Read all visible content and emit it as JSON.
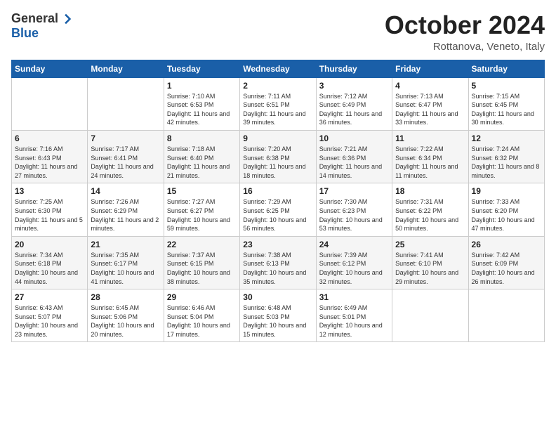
{
  "header": {
    "logo_general": "General",
    "logo_blue": "Blue",
    "month_title": "October 2024",
    "location": "Rottanova, Veneto, Italy"
  },
  "weekdays": [
    "Sunday",
    "Monday",
    "Tuesday",
    "Wednesday",
    "Thursday",
    "Friday",
    "Saturday"
  ],
  "weeks": [
    [
      {
        "day": "",
        "info": ""
      },
      {
        "day": "",
        "info": ""
      },
      {
        "day": "1",
        "info": "Sunrise: 7:10 AM\nSunset: 6:53 PM\nDaylight: 11 hours and 42 minutes."
      },
      {
        "day": "2",
        "info": "Sunrise: 7:11 AM\nSunset: 6:51 PM\nDaylight: 11 hours and 39 minutes."
      },
      {
        "day": "3",
        "info": "Sunrise: 7:12 AM\nSunset: 6:49 PM\nDaylight: 11 hours and 36 minutes."
      },
      {
        "day": "4",
        "info": "Sunrise: 7:13 AM\nSunset: 6:47 PM\nDaylight: 11 hours and 33 minutes."
      },
      {
        "day": "5",
        "info": "Sunrise: 7:15 AM\nSunset: 6:45 PM\nDaylight: 11 hours and 30 minutes."
      }
    ],
    [
      {
        "day": "6",
        "info": "Sunrise: 7:16 AM\nSunset: 6:43 PM\nDaylight: 11 hours and 27 minutes."
      },
      {
        "day": "7",
        "info": "Sunrise: 7:17 AM\nSunset: 6:41 PM\nDaylight: 11 hours and 24 minutes."
      },
      {
        "day": "8",
        "info": "Sunrise: 7:18 AM\nSunset: 6:40 PM\nDaylight: 11 hours and 21 minutes."
      },
      {
        "day": "9",
        "info": "Sunrise: 7:20 AM\nSunset: 6:38 PM\nDaylight: 11 hours and 18 minutes."
      },
      {
        "day": "10",
        "info": "Sunrise: 7:21 AM\nSunset: 6:36 PM\nDaylight: 11 hours and 14 minutes."
      },
      {
        "day": "11",
        "info": "Sunrise: 7:22 AM\nSunset: 6:34 PM\nDaylight: 11 hours and 11 minutes."
      },
      {
        "day": "12",
        "info": "Sunrise: 7:24 AM\nSunset: 6:32 PM\nDaylight: 11 hours and 8 minutes."
      }
    ],
    [
      {
        "day": "13",
        "info": "Sunrise: 7:25 AM\nSunset: 6:30 PM\nDaylight: 11 hours and 5 minutes."
      },
      {
        "day": "14",
        "info": "Sunrise: 7:26 AM\nSunset: 6:29 PM\nDaylight: 11 hours and 2 minutes."
      },
      {
        "day": "15",
        "info": "Sunrise: 7:27 AM\nSunset: 6:27 PM\nDaylight: 10 hours and 59 minutes."
      },
      {
        "day": "16",
        "info": "Sunrise: 7:29 AM\nSunset: 6:25 PM\nDaylight: 10 hours and 56 minutes."
      },
      {
        "day": "17",
        "info": "Sunrise: 7:30 AM\nSunset: 6:23 PM\nDaylight: 10 hours and 53 minutes."
      },
      {
        "day": "18",
        "info": "Sunrise: 7:31 AM\nSunset: 6:22 PM\nDaylight: 10 hours and 50 minutes."
      },
      {
        "day": "19",
        "info": "Sunrise: 7:33 AM\nSunset: 6:20 PM\nDaylight: 10 hours and 47 minutes."
      }
    ],
    [
      {
        "day": "20",
        "info": "Sunrise: 7:34 AM\nSunset: 6:18 PM\nDaylight: 10 hours and 44 minutes."
      },
      {
        "day": "21",
        "info": "Sunrise: 7:35 AM\nSunset: 6:17 PM\nDaylight: 10 hours and 41 minutes."
      },
      {
        "day": "22",
        "info": "Sunrise: 7:37 AM\nSunset: 6:15 PM\nDaylight: 10 hours and 38 minutes."
      },
      {
        "day": "23",
        "info": "Sunrise: 7:38 AM\nSunset: 6:13 PM\nDaylight: 10 hours and 35 minutes."
      },
      {
        "day": "24",
        "info": "Sunrise: 7:39 AM\nSunset: 6:12 PM\nDaylight: 10 hours and 32 minutes."
      },
      {
        "day": "25",
        "info": "Sunrise: 7:41 AM\nSunset: 6:10 PM\nDaylight: 10 hours and 29 minutes."
      },
      {
        "day": "26",
        "info": "Sunrise: 7:42 AM\nSunset: 6:09 PM\nDaylight: 10 hours and 26 minutes."
      }
    ],
    [
      {
        "day": "27",
        "info": "Sunrise: 6:43 AM\nSunset: 5:07 PM\nDaylight: 10 hours and 23 minutes."
      },
      {
        "day": "28",
        "info": "Sunrise: 6:45 AM\nSunset: 5:06 PM\nDaylight: 10 hours and 20 minutes."
      },
      {
        "day": "29",
        "info": "Sunrise: 6:46 AM\nSunset: 5:04 PM\nDaylight: 10 hours and 17 minutes."
      },
      {
        "day": "30",
        "info": "Sunrise: 6:48 AM\nSunset: 5:03 PM\nDaylight: 10 hours and 15 minutes."
      },
      {
        "day": "31",
        "info": "Sunrise: 6:49 AM\nSunset: 5:01 PM\nDaylight: 10 hours and 12 minutes."
      },
      {
        "day": "",
        "info": ""
      },
      {
        "day": "",
        "info": ""
      }
    ]
  ]
}
